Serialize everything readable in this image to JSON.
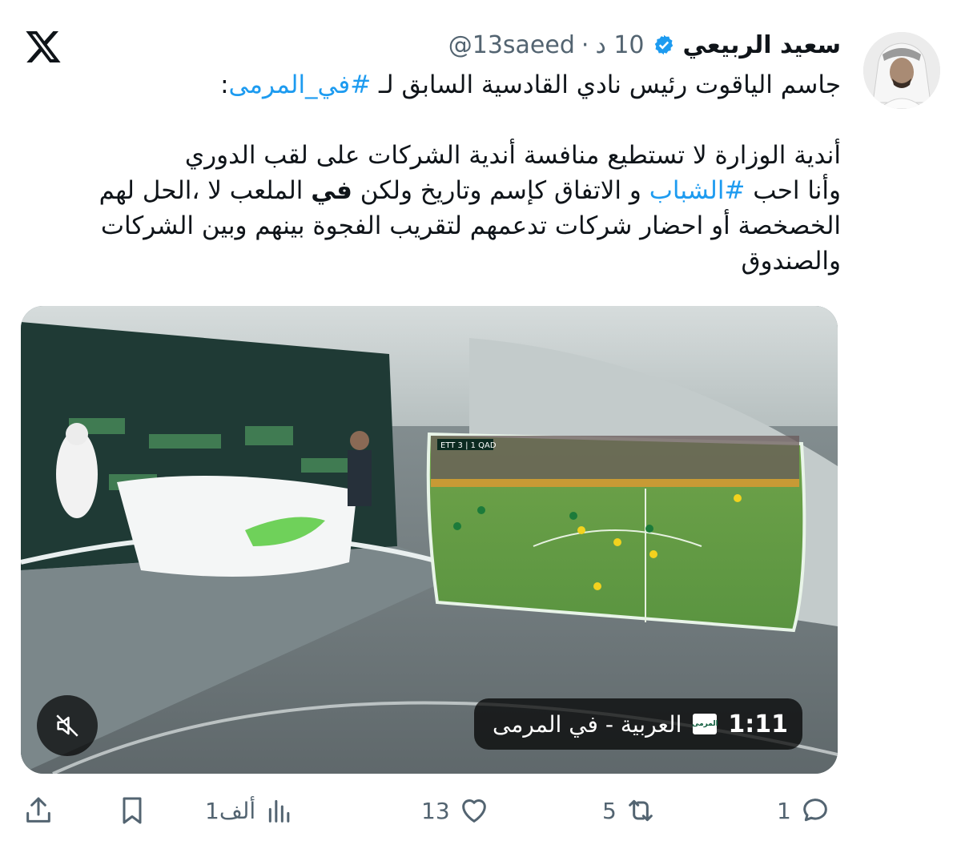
{
  "author": {
    "display_name": "سعيد الربيعي",
    "handle": "@13saeed",
    "time": "10 د",
    "separator": "·"
  },
  "tweet": {
    "line1_prefix": "جاسم الياقوت رئيس نادي القادسية السابق لـ ",
    "line1_tag": "#في_المرمى",
    "line1_suffix": ":",
    "p1": "أندية الوزارة لا تستطيع منافسة أندية الشركات على لقب الدوري",
    "p2_a": "وأنا احب ",
    "p2_tag": "#الشباب",
    "p2_b": " و الاتفاق كإسم وتاريخ ولكن ",
    "p2_bold": "في",
    "p2_c": " الملعب لا ،الحل لهم",
    "p3": "الخصخصة أو احضار شركات تدعمهم لتقريب الفجوة بينهم وبين الشركات",
    "p4": "والصندوق"
  },
  "video": {
    "duration": "1:11",
    "channel": "العربية - في المرمى",
    "channel_logo_text": "المرمى",
    "muted": true,
    "scoreboard": "ETT 3 | 1 QAD"
  },
  "actions": {
    "replies": "1",
    "reposts": "5",
    "likes": "13",
    "views": "1ألف"
  },
  "colors": {
    "link": "#1d9bf0",
    "muted_text": "#536471",
    "verified": "#1d9bf0",
    "gold_badge": "#e2b719"
  }
}
